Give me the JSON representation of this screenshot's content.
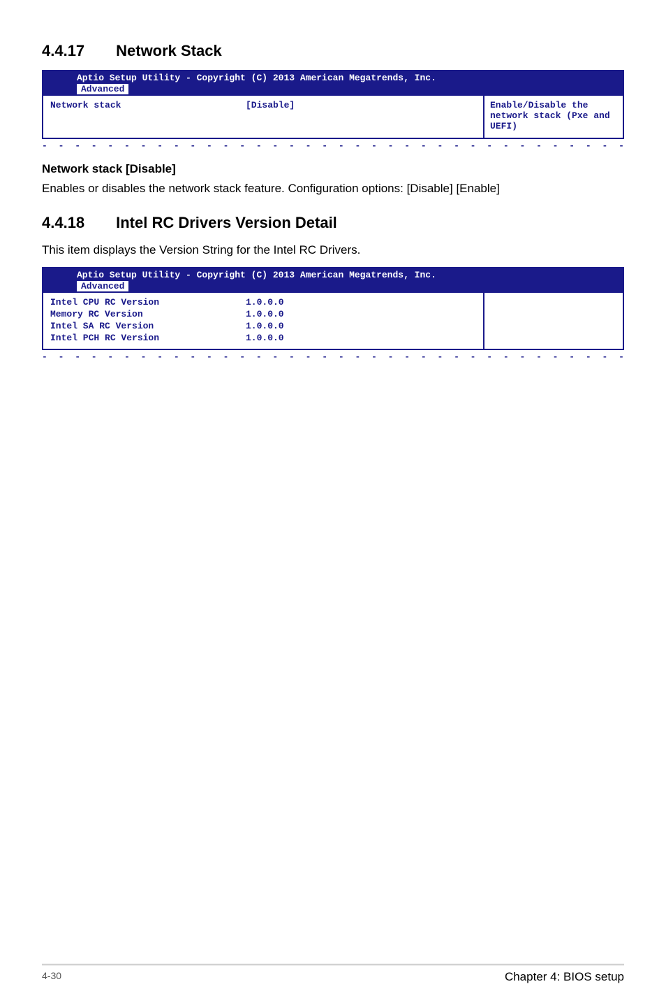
{
  "section1": {
    "number": "4.4.17",
    "title": "Network Stack",
    "bios": {
      "header": "Aptio Setup Utility - Copyright (C) 2013 American Megatrends, Inc.",
      "tab": "Advanced",
      "rows": [
        {
          "label": "Network stack",
          "value": "[Disable]"
        }
      ],
      "help": "Enable/Disable the network stack (Pxe and UEFI)"
    },
    "sub": {
      "heading": "Network stack [Disable]",
      "text": "Enables or disables the network stack feature. Configuration options: [Disable] [Enable]"
    }
  },
  "section2": {
    "number": "4.4.18",
    "title": "Intel RC Drivers Version Detail",
    "intro": "This item displays the Version String for the Intel RC Drivers.",
    "bios": {
      "header": "Aptio Setup Utility - Copyright (C) 2013 American Megatrends, Inc.",
      "tab": "Advanced",
      "rows": [
        {
          "label": "Intel CPU RC Version",
          "value": "1.0.0.0"
        },
        {
          "label": "Memory RC Version",
          "value": "1.0.0.0"
        },
        {
          "label": "Intel SA RC Version",
          "value": "1.0.0.0"
        },
        {
          "label": "Intel PCH RC Version",
          "value": "1.0.0.0"
        }
      ],
      "help": ""
    }
  },
  "footer": {
    "page": "4-30",
    "chapter": "Chapter 4: BIOS setup"
  },
  "dashes": "- - - - - - - - - - - - - - - - - - - - - - - - - - - - - - - - - - - - - - - - - - - - - - - - -"
}
